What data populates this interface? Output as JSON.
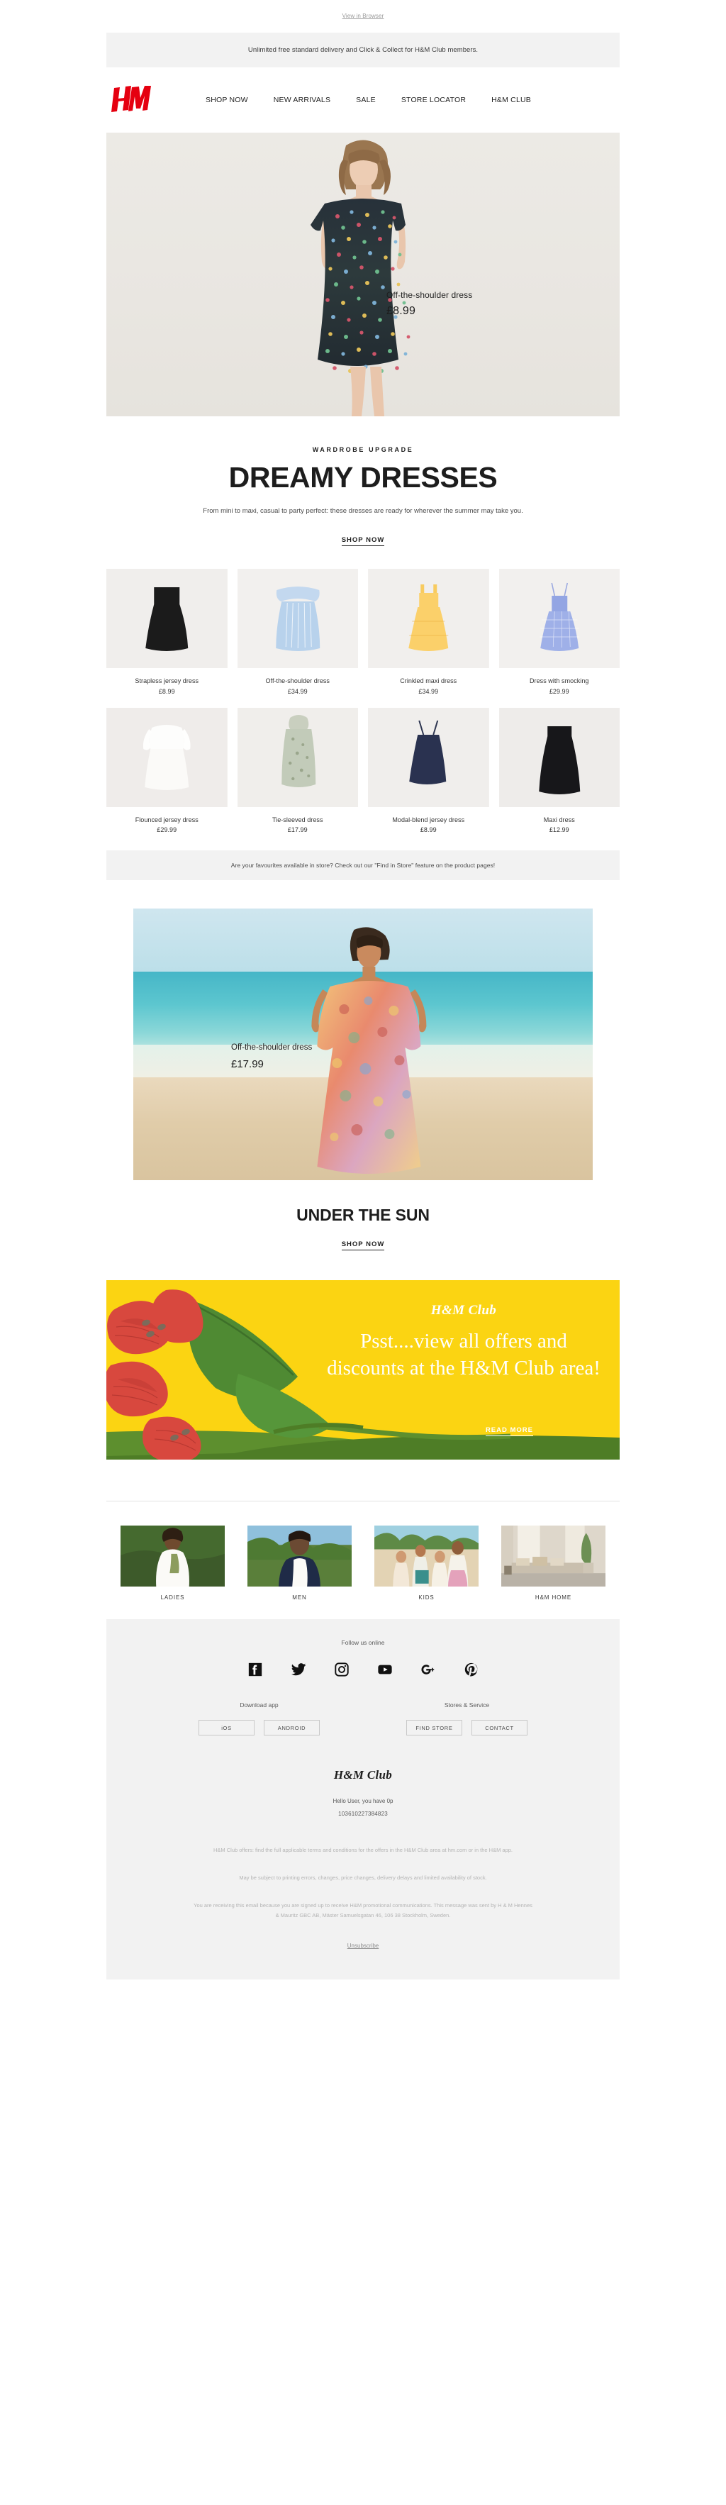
{
  "preheader": {
    "view_in_browser": "View in Browser",
    "promo": "Unlimited free standard delivery and Click & Collect for H&M Club members."
  },
  "nav": {
    "logo_alt": "H&M",
    "links": [
      {
        "label": "SHOP NOW"
      },
      {
        "label": "NEW ARRIVALS"
      },
      {
        "label": "SALE"
      },
      {
        "label": "STORE LOCATOR"
      },
      {
        "label": "H&M CLUB"
      }
    ]
  },
  "hero": {
    "product_name": "Off-the-shoulder dress",
    "price": "£8.99"
  },
  "headline": {
    "eyebrow": "WARDROBE UPGRADE",
    "title": "DREAMY DRESSES",
    "copy": "From mini to maxi, casual to party perfect: these dresses are ready for wherever the summer may take you.",
    "cta": "SHOP NOW"
  },
  "products": [
    {
      "name": "Strapless jersey dress",
      "price": "£8.99"
    },
    {
      "name": "Off-the-shoulder dress",
      "price": "£34.99"
    },
    {
      "name": "Crinkled maxi dress",
      "price": "£34.99"
    },
    {
      "name": "Dress with smocking",
      "price": "£29.99"
    },
    {
      "name": "Flounced jersey dress",
      "price": "£29.99"
    },
    {
      "name": "Tie-sleeved dress",
      "price": "£17.99"
    },
    {
      "name": "Modal-blend jersey dress",
      "price": "£8.99"
    },
    {
      "name": "Maxi dress",
      "price": "£12.99"
    }
  ],
  "info_strip": {
    "text": "Are your favourites available in store? Check out our \"Find in Store\" feature on the product pages!"
  },
  "hero2": {
    "product_name": "Off-the-shoulder dress",
    "price": "£17.99",
    "title": "UNDER THE SUN",
    "cta": "SHOP NOW"
  },
  "club_banner": {
    "logo": "H&M Club",
    "headline": "Psst....view all offers and discounts at the H&M Club area!",
    "cta": "READ MORE",
    "background_color": "#fbd412"
  },
  "categories": [
    {
      "label": "LADIES"
    },
    {
      "label": "MEN"
    },
    {
      "label": "KIDS"
    },
    {
      "label": "H&M HOME"
    }
  ],
  "footer": {
    "follow_label": "Follow us online",
    "socials": [
      {
        "name": "facebook-icon"
      },
      {
        "name": "twitter-icon"
      },
      {
        "name": "instagram-icon"
      },
      {
        "name": "youtube-icon"
      },
      {
        "name": "googleplus-icon"
      },
      {
        "name": "pinterest-icon"
      }
    ],
    "download_app_title": "Download app",
    "stores_service_title": "Stores & Service",
    "buttons": {
      "ios": "iOS",
      "android": "ANDROID",
      "find_store": "FIND STORE",
      "contact": "CONTACT"
    },
    "club_logo": "H&M Club",
    "club_hello": "Hello User, you have 0p",
    "club_id": "103610227384823",
    "legal_1": "H&M Club offers: find the full applicable terms and conditions for the offers in the H&M Club area at hm.com or in the H&M app.",
    "legal_2": "May be subject to printing errors, changes, price changes, delivery delays and limited availability of stock.",
    "legal_3": "You are receiving this email because you are signed up to receive H&M promotional communications. This message was sent by H & M Hennes & Mauritz GBC AB, Mäster Samuelsgatan 46, 106 38 Stockholm, Sweden.",
    "unsubscribe": "Unsubscribe"
  },
  "brand_color": "#e50010"
}
